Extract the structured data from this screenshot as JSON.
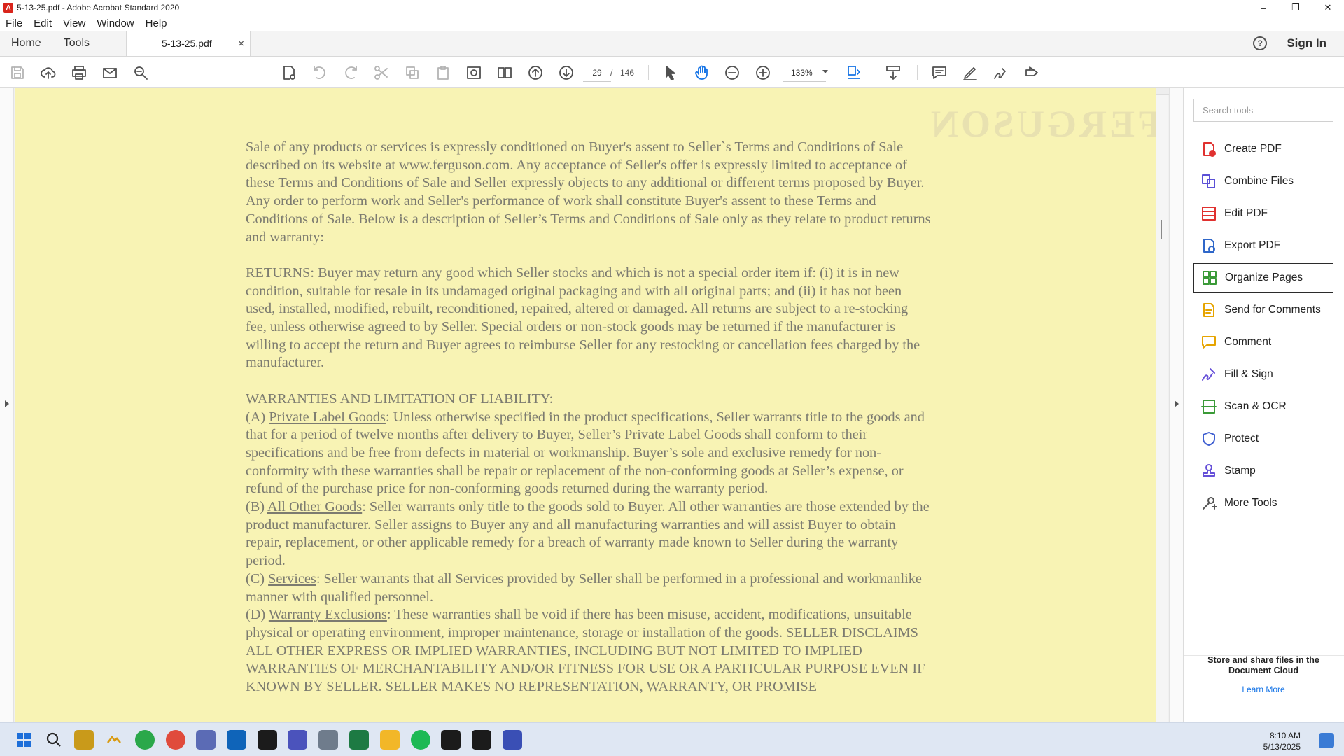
{
  "window": {
    "title": "5-13-25.pdf - Adobe Acrobat Standard 2020",
    "controls": [
      "–",
      "❐",
      "✕"
    ]
  },
  "menu": [
    "File",
    "Edit",
    "View",
    "Window",
    "Help"
  ],
  "tabs": {
    "home": "Home",
    "tools": "Tools",
    "document": "5-13-25.pdf",
    "close": "×",
    "help": "?",
    "sign_in": "Sign In"
  },
  "toolbar": {
    "page_current": "29",
    "page_separator": "/",
    "page_total": "146",
    "zoom": "133%"
  },
  "document": {
    "paragraphs": [
      "Sale of any products or services is expressly conditioned on Buyer's assent to Seller`s Terms and Conditions of Sale described on its website at www.ferguson.com. Any acceptance of Seller's offer is expressly limited to acceptance of these Terms and Conditions of Sale and Seller expressly objects to any additional or different terms proposed by Buyer. Any order to perform work and Seller's performance of work shall constitute Buyer's assent to these Terms and Conditions of Sale. Below is a description of Seller’s Terms and Conditions of Sale only as they relate to product returns and warranty:",
      "RETURNS: Buyer may return any good which Seller stocks and which is not a special order item if: (i) it is in new condition, suitable for resale in its undamaged original packaging and with all original parts; and (ii) it has not been used, installed, modified, rebuilt, reconditioned, repaired, altered or damaged. All returns are subject to a re-stocking fee, unless otherwise agreed to by Seller. Special orders or non-stock goods may be returned if the manufacturer is willing to accept the return and Buyer agrees to reimburse Seller for any restocking or cancellation fees charged by the manufacturer."
    ],
    "warranty_heading": "WARRANTIES AND LIMITATION OF LIABILITY:",
    "warranty_sections": [
      {
        "prefix": "(A) ",
        "title": "Private Label Goods",
        "body": ": Unless otherwise specified in the product specifications, Seller warrants title to the goods and that for a period of twelve months after delivery to Buyer, Seller’s Private Label Goods shall conform to their specifications and be free from defects in material or workmanship. Buyer’s sole and exclusive remedy for non-conformity with these warranties shall be repair or replacement of the non-conforming goods at Seller’s expense, or refund of the purchase price for non-conforming goods returned during the warranty period."
      },
      {
        "prefix": "(B) ",
        "title": "All Other Goods",
        "body": ": Seller warrants only title to the goods sold to Buyer. All other warranties are those extended by the product manufacturer. Seller assigns to Buyer any and all manufacturing warranties and will assist Buyer to obtain repair, replacement, or other applicable remedy for a breach of warranty made known to Seller during the warranty period."
      },
      {
        "prefix": "(C) ",
        "title": "Services",
        "body": ": Seller warrants that all Services provided by Seller shall be performed in a professional and workmanlike manner with qualified personnel."
      },
      {
        "prefix": "(D) ",
        "title": "Warranty Exclusions",
        "body": ": These warranties shall be void if there has been misuse, accident, modifications, unsuitable physical or operating environment, improper maintenance, storage or installation of the goods. SELLER DISCLAIMS ALL OTHER EXPRESS OR IMPLIED WARRANTIES, INCLUDING BUT NOT LIMITED TO IMPLIED WARRANTIES OF MERCHANTABILITY AND/OR FITNESS FOR USE OR A PARTICULAR PURPOSE EVEN IF KNOWN BY SELLER. SELLER MAKES NO REPRESENTATION, WARRANTY, OR PROMISE"
      }
    ],
    "ghost_stamp": "FERGUSON"
  },
  "tools_pane": {
    "search_placeholder": "Search tools",
    "items": [
      {
        "label": "Create PDF",
        "icon": "create-pdf-icon",
        "color": "#e0312f"
      },
      {
        "label": "Combine Files",
        "icon": "combine-files-icon",
        "color": "#5b50d6"
      },
      {
        "label": "Edit PDF",
        "icon": "edit-pdf-icon",
        "color": "#e0312f"
      },
      {
        "label": "Export PDF",
        "icon": "export-pdf-icon",
        "color": "#2f67c9"
      },
      {
        "label": "Organize Pages",
        "icon": "organize-pages-icon",
        "color": "#3a9a37"
      },
      {
        "label": "Send for Comments",
        "icon": "send-for-comments-icon",
        "color": "#e6a400"
      },
      {
        "label": "Comment",
        "icon": "comment-icon",
        "color": "#e6a400"
      },
      {
        "label": "Fill & Sign",
        "icon": "fill-sign-icon",
        "color": "#6650d8"
      },
      {
        "label": "Scan & OCR",
        "icon": "scan-ocr-icon",
        "color": "#3a9a37"
      },
      {
        "label": "Protect",
        "icon": "protect-icon",
        "color": "#3f5fd1"
      },
      {
        "label": "Stamp",
        "icon": "stamp-icon",
        "color": "#6650d8"
      },
      {
        "label": "More Tools",
        "icon": "more-tools-icon",
        "color": "#555555"
      }
    ],
    "cloud_heading": "Store and share files in the Document Cloud",
    "cloud_link": "Learn More"
  },
  "taskbar": {
    "time": "8:10 AM",
    "date": "5/13/2025"
  },
  "colors": {
    "page_background": "#f8f3b4",
    "accent": "#1473e6"
  }
}
